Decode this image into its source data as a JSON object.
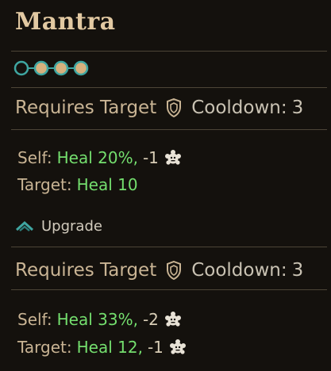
{
  "skill": {
    "name": "Mantra",
    "colors": {
      "title": "#e2c9a2",
      "heal": "#74df6e",
      "bead_filled": "#d7b07d",
      "bead_ring": "#3fa6a1"
    },
    "rank_beads": {
      "icon": "rank-beads-icon",
      "filled": 3,
      "total": 4
    },
    "base": {
      "requirement": "Requires Target",
      "shield_icon": "shield-icon",
      "cooldown_label": "Cooldown:",
      "cooldown_value": "3",
      "self_label": "Self:",
      "self_heal": "Heal 20%,",
      "self_stress": "-1",
      "self_icon": "stress-icon",
      "target_label": "Target:",
      "target_heal": "Heal 10"
    },
    "upgrade": {
      "label": "Upgrade",
      "icon": "upgrade-chevron-icon"
    },
    "upgraded": {
      "requirement": "Requires Target",
      "shield_icon": "shield-icon",
      "cooldown_label": "Cooldown:",
      "cooldown_value": "3",
      "self_label": "Self:",
      "self_heal": "Heal 33%,",
      "self_stress": "-2",
      "self_icon": "stress-icon",
      "target_label": "Target:",
      "target_heal": "Heal 12,",
      "target_stress": "-1",
      "target_icon": "stress-icon"
    }
  }
}
